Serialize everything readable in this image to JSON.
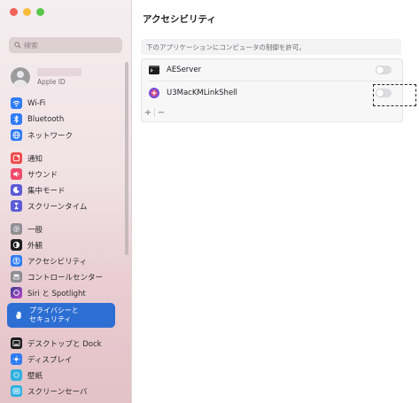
{
  "window": {
    "title": "アクセシビリティ"
  },
  "sidebar": {
    "search_placeholder": "検索",
    "account": {
      "subtitle": "Apple ID"
    },
    "items": [
      {
        "label": "Wi-Fi",
        "icon": "wifi-icon",
        "color": "#2f7cf6"
      },
      {
        "label": "Bluetooth",
        "icon": "bluetooth-icon",
        "color": "#2f7cf6"
      },
      {
        "label": "ネットワーク",
        "icon": "globe-icon",
        "color": "#2f7cf6"
      },
      {
        "label": "通知",
        "icon": "bell-icon",
        "color": "#ef4b4b"
      },
      {
        "label": "サウンド",
        "icon": "speaker-icon",
        "color": "#ef4b6b"
      },
      {
        "label": "集中モード",
        "icon": "moon-icon",
        "color": "#5b5bd6"
      },
      {
        "label": "スクリーンタイム",
        "icon": "hourglass-icon",
        "color": "#5b5bd6"
      },
      {
        "label": "一般",
        "icon": "gear-icon",
        "color": "#8e8e93"
      },
      {
        "label": "外観",
        "icon": "appearance-icon",
        "color": "#1d1d1f"
      },
      {
        "label": "アクセシビリティ",
        "icon": "accessibility-icon",
        "color": "#2f7cf6"
      },
      {
        "label": "コントロールセンター",
        "icon": "control-center-icon",
        "color": "#8e8e93"
      },
      {
        "label": "Siri と Spotlight",
        "icon": "siri-icon",
        "color": "#3a3a8c"
      },
      {
        "label": "プライバシーと\nセキュリティ",
        "icon": "hand-icon",
        "color": "#2d6ed3",
        "selected": true
      },
      {
        "label": "デスクトップと Dock",
        "icon": "dock-icon",
        "color": "#1d1d1f"
      },
      {
        "label": "ディスプレイ",
        "icon": "display-icon",
        "color": "#2f7cf6"
      },
      {
        "label": "壁紙",
        "icon": "wallpaper-icon",
        "color": "#30b0e0"
      },
      {
        "label": "スクリーンセーバ",
        "icon": "screensaver-icon",
        "color": "#30b0e0"
      }
    ]
  },
  "main": {
    "description": "下のアプリケーションにコンピュータの制御を許可。",
    "apps": [
      {
        "name": "AEServer",
        "icon": "terminal-app-icon",
        "enabled": false
      },
      {
        "name": "U3MacKMLinkShell",
        "icon": "u3-app-icon",
        "enabled": false
      }
    ],
    "add_label": "+",
    "remove_label": "−"
  },
  "colors": {
    "accent": "#2d6ed3",
    "annotation": "#222222"
  }
}
